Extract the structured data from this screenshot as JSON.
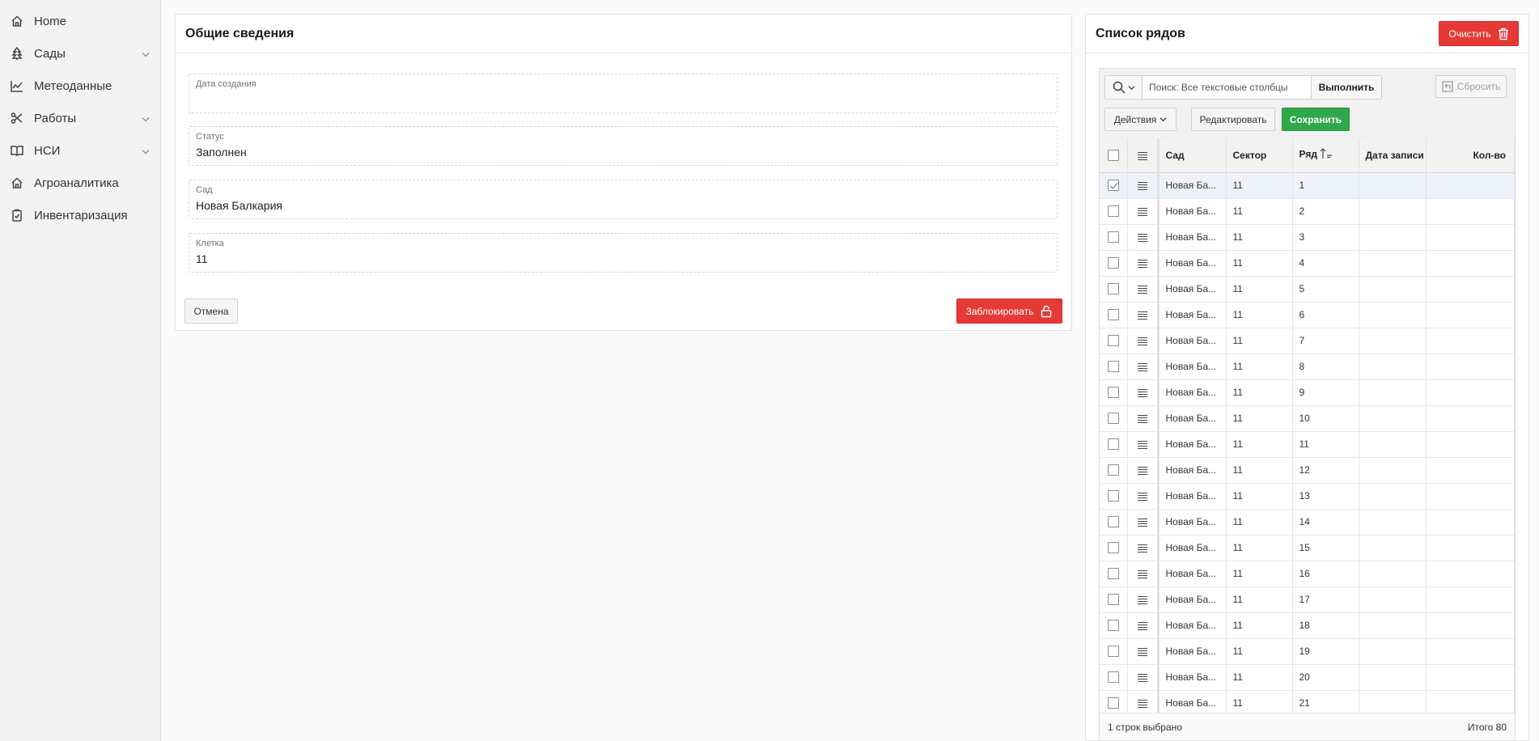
{
  "sidebar": {
    "items": [
      {
        "label": "Home",
        "icon": "home-icon",
        "expandable": false
      },
      {
        "label": "Сады",
        "icon": "tree-icon",
        "expandable": true
      },
      {
        "label": "Метеоданные",
        "icon": "chart-line-icon",
        "expandable": false
      },
      {
        "label": "Работы",
        "icon": "scissors-icon",
        "expandable": true
      },
      {
        "label": "НСИ",
        "icon": "book-icon",
        "expandable": true
      },
      {
        "label": "Агроаналитика",
        "icon": "home-icon",
        "expandable": false
      },
      {
        "label": "Инвентаризация",
        "icon": "clipboard-icon",
        "expandable": false
      }
    ]
  },
  "general": {
    "title": "Общие сведения",
    "fields": [
      {
        "label": "Дата создания",
        "value": ""
      },
      {
        "label": "Статус",
        "value": "Заполнен"
      },
      {
        "label": "Сад",
        "value": "Новая Балкария"
      },
      {
        "label": "Клетка",
        "value": "11"
      }
    ],
    "cancel_label": "Отмена",
    "lock_label": "Заблокировать"
  },
  "rows_list": {
    "title": "Список рядов",
    "clear_label": "Очистить",
    "search_placeholder": "Поиск: Все текстовые столбцы",
    "go_label": "Выполнить",
    "reset_label": "Сбросить",
    "actions_label": "Действия",
    "edit_label": "Редактировать",
    "save_label": "Сохранить",
    "columns": [
      "Сад",
      "Сектор",
      "Ряд",
      "Дата записи",
      "Кол-во"
    ],
    "rows": [
      {
        "garden": "Новая Ба...",
        "sector": "11",
        "row": "1",
        "selected": true
      },
      {
        "garden": "Новая Ба...",
        "sector": "11",
        "row": "2",
        "selected": false
      },
      {
        "garden": "Новая Ба...",
        "sector": "11",
        "row": "3",
        "selected": false
      },
      {
        "garden": "Новая Ба...",
        "sector": "11",
        "row": "4",
        "selected": false
      },
      {
        "garden": "Новая Ба...",
        "sector": "11",
        "row": "5",
        "selected": false
      },
      {
        "garden": "Новая Ба...",
        "sector": "11",
        "row": "6",
        "selected": false
      },
      {
        "garden": "Новая Ба...",
        "sector": "11",
        "row": "7",
        "selected": false
      },
      {
        "garden": "Новая Ба...",
        "sector": "11",
        "row": "8",
        "selected": false
      },
      {
        "garden": "Новая Ба...",
        "sector": "11",
        "row": "9",
        "selected": false
      },
      {
        "garden": "Новая Ба...",
        "sector": "11",
        "row": "10",
        "selected": false
      },
      {
        "garden": "Новая Ба...",
        "sector": "11",
        "row": "11",
        "selected": false
      },
      {
        "garden": "Новая Ба...",
        "sector": "11",
        "row": "12",
        "selected": false
      },
      {
        "garden": "Новая Ба...",
        "sector": "11",
        "row": "13",
        "selected": false
      },
      {
        "garden": "Новая Ба...",
        "sector": "11",
        "row": "14",
        "selected": false
      },
      {
        "garden": "Новая Ба...",
        "sector": "11",
        "row": "15",
        "selected": false
      },
      {
        "garden": "Новая Ба...",
        "sector": "11",
        "row": "16",
        "selected": false
      },
      {
        "garden": "Новая Ба...",
        "sector": "11",
        "row": "17",
        "selected": false
      },
      {
        "garden": "Новая Ба...",
        "sector": "11",
        "row": "18",
        "selected": false
      },
      {
        "garden": "Новая Ба...",
        "sector": "11",
        "row": "19",
        "selected": false
      },
      {
        "garden": "Новая Ба...",
        "sector": "11",
        "row": "20",
        "selected": false
      },
      {
        "garden": "Новая Ба...",
        "sector": "11",
        "row": "21",
        "selected": false
      }
    ],
    "selected_text": "1 строк выбрано",
    "total_text": "Итого 80"
  },
  "colors": {
    "danger": "#e53935",
    "success": "#2ea84a"
  }
}
